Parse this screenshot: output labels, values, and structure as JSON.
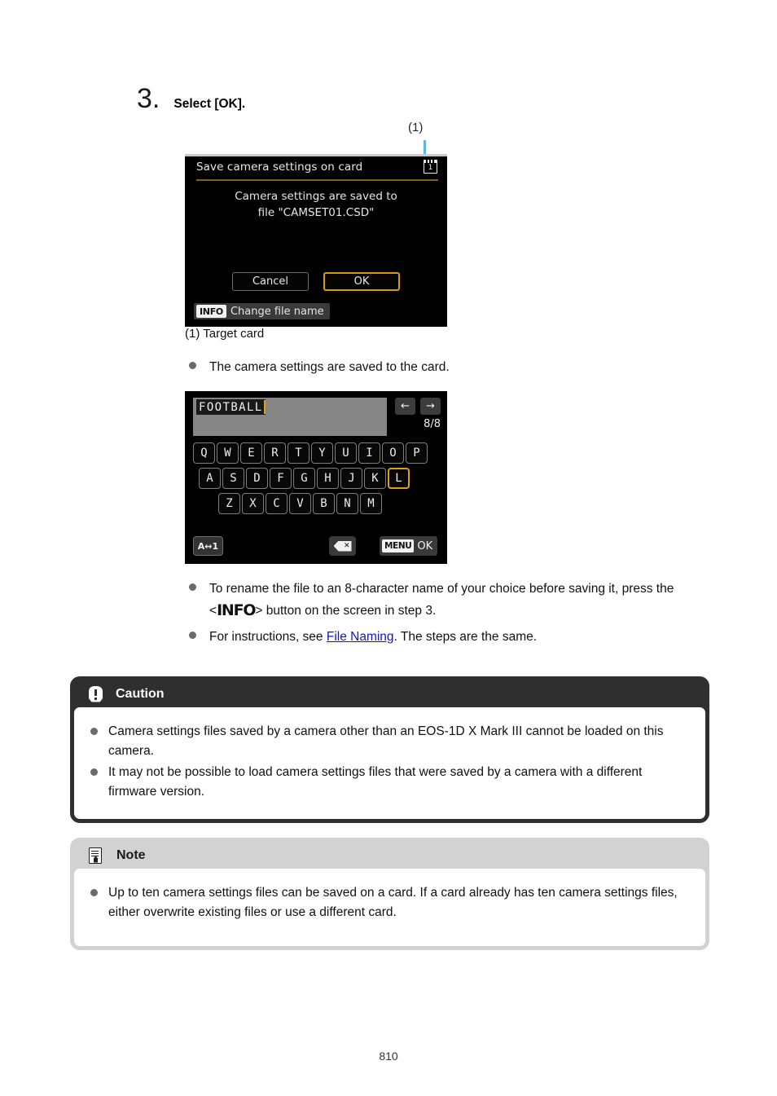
{
  "step": {
    "number": "3.",
    "title": "Select [OK]."
  },
  "callout": {
    "label": "(1)"
  },
  "save_dialog": {
    "title": "Save camera settings on card",
    "card_icon_number": "1",
    "message_line1": "Camera settings are saved to",
    "message_line2": "file \"CAMSET01.CSD\"",
    "cancel_label": "Cancel",
    "ok_label": "OK",
    "info_badge": "INFO",
    "info_action": "Change file name",
    "selected_button": "OK",
    "accent_color": "#d39a15"
  },
  "target_card_caption": "(1) Target card",
  "bullets": {
    "saved_to_card": "The camera settings are saved to the card.",
    "rename_part1": "To rename the file to an 8-character name of your choice before saving it, press the <",
    "rename_info": "INFO",
    "rename_part2": "> button on the screen in step 3.",
    "instructions_part1": "For instructions, see ",
    "instructions_link": "File Naming",
    "instructions_part2": ". The steps are the same."
  },
  "keyboard": {
    "entry_text": "FOOTBALL",
    "char_count": "8/8",
    "arrow_left": "←",
    "arrow_right": "→",
    "row1": [
      "Q",
      "W",
      "E",
      "R",
      "T",
      "Y",
      "U",
      "I",
      "O",
      "P"
    ],
    "row2": [
      "A",
      "S",
      "D",
      "F",
      "G",
      "H",
      "J",
      "K",
      "L"
    ],
    "row3": [
      "Z",
      "X",
      "C",
      "V",
      "B",
      "N",
      "M"
    ],
    "selected_key": "L",
    "mode_label": "A↔1",
    "delete_label": "✕",
    "menu_badge": "MENU",
    "ok_label": "OK",
    "accent_color": "#d9a21a"
  },
  "caution": {
    "heading": "Caution",
    "items": [
      "Camera settings files saved by a camera other than an EOS-1D X Mark III cannot be loaded on this camera.",
      "It may not be possible to load camera settings files that were saved by a camera with a different firmware version."
    ]
  },
  "note": {
    "heading": "Note",
    "items": [
      "Up to ten camera settings files can be saved on a card. If a card already has ten camera settings files, either overwrite existing files or use a different card."
    ]
  },
  "page_number": "810"
}
